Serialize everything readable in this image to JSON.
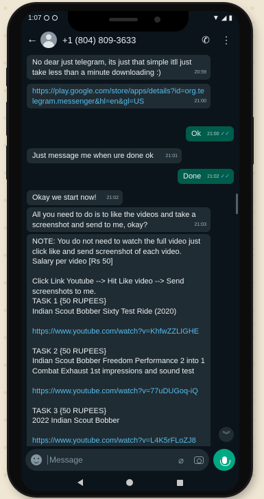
{
  "status": {
    "time": "1:07"
  },
  "header": {
    "contact_name": "+1 (804) 809-3633"
  },
  "messages": [
    {
      "dir": "in",
      "text": "No dear just telegram, its just that simple itll just take less than a minute downloading :)",
      "time": "20:59"
    },
    {
      "dir": "in",
      "link": "https://play.google.com/store/apps/details?id=org.telegram.messenger&hl=en&gl=US",
      "time": "21:00"
    },
    {
      "dir": "out",
      "text": "Ok",
      "time": "21:00"
    },
    {
      "dir": "in",
      "text": "Just message me when ure done ok",
      "time": "21:01"
    },
    {
      "dir": "out",
      "text": "Done",
      "time": "21:02"
    },
    {
      "dir": "in",
      "text": "Okay we start now!",
      "time": "21:02"
    },
    {
      "dir": "in",
      "text": "All you need to do is to like the videos and take a screenshot and send to me, okay?",
      "time": "21:03"
    }
  ],
  "long_message": {
    "note": "NOTE: You do not need to watch the full video just click like and send screenshot of each video.\nSalary per video [Rs 50]",
    "steps": "Click Link Youtube --> Hit Like video --> Send screenshots to me.",
    "task1_title": "TASK 1 {50 RUPEES}",
    "task1_desc": "Indian Scout Bobber Sixty Test Ride (2020)",
    "task1_link": "https://www.youtube.com/watch?v=KhfwZZLIGHE",
    "task2_title": "TASK 2 {50 RUPEES}",
    "task2_desc": "Indian Scout Bobber Freedom Performance 2 into 1 Combat Exhaust 1st impressions and sound test",
    "task2_link": "https://www.youtube.com/watch?v=77uDUGoq-iQ",
    "task3_title": "TASK 3 {50 RUPEES}",
    "task3_desc": "2022 Indian Scout Bobber",
    "task3_link": "https://www.youtube.com/watch?v=L4K5rFLoZJ8"
  },
  "input": {
    "placeholder": "Message"
  },
  "colors": {
    "incoming": "#202c33",
    "outgoing": "#005c4b",
    "link": "#53bdeb",
    "accent": "#00a884"
  }
}
